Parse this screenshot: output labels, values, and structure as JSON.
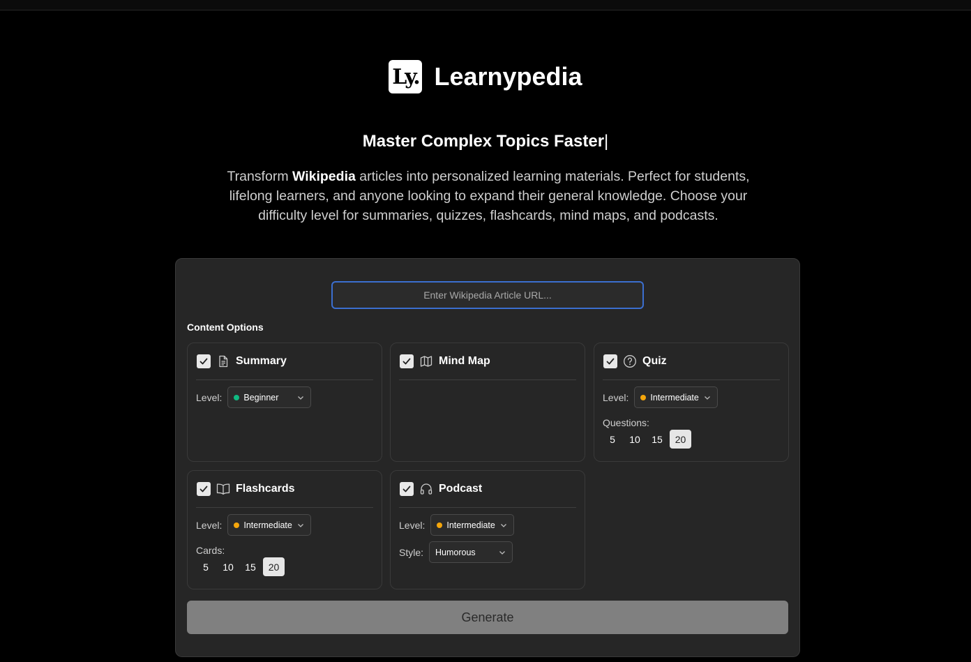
{
  "brand": {
    "logo_text": "Ly.",
    "name": "Learnypedia"
  },
  "hero": {
    "tagline": "Master Complex Topics Faster",
    "caret": "|",
    "intro_before": "Transform ",
    "intro_bold": "Wikipedia",
    "intro_after": " articles into personalized learning materials. Perfect for students, lifelong learners, and anyone looking to expand their general knowledge. Choose your difficulty level for summaries, quizzes, flashcards, mind maps, and podcasts."
  },
  "form": {
    "url_placeholder": "Enter Wikipedia Article URL...",
    "section_label": "Content Options",
    "generate_label": "Generate"
  },
  "colors": {
    "beginner": "#10b981",
    "intermediate": "#f5a60b",
    "input_focus": "#3b6fd0"
  },
  "cards": {
    "summary": {
      "title": "Summary",
      "icon": "document-icon",
      "checked": true,
      "level_label": "Level:",
      "level": "Beginner"
    },
    "mindmap": {
      "title": "Mind Map",
      "icon": "map-icon",
      "checked": true
    },
    "quiz": {
      "title": "Quiz",
      "icon": "question-circle-icon",
      "checked": true,
      "level_label": "Level:",
      "level": "Intermediate",
      "count_label": "Questions:",
      "counts": [
        "5",
        "10",
        "15",
        "20"
      ],
      "selected": "20"
    },
    "flashcards": {
      "title": "Flashcards",
      "icon": "open-book-icon",
      "checked": true,
      "level_label": "Level:",
      "level": "Intermediate",
      "count_label": "Cards:",
      "counts": [
        "5",
        "10",
        "15",
        "20"
      ],
      "selected": "20"
    },
    "podcast": {
      "title": "Podcast",
      "icon": "headphones-icon",
      "checked": true,
      "level_label": "Level:",
      "level": "Intermediate",
      "style_label": "Style:",
      "style": "Humorous"
    }
  }
}
